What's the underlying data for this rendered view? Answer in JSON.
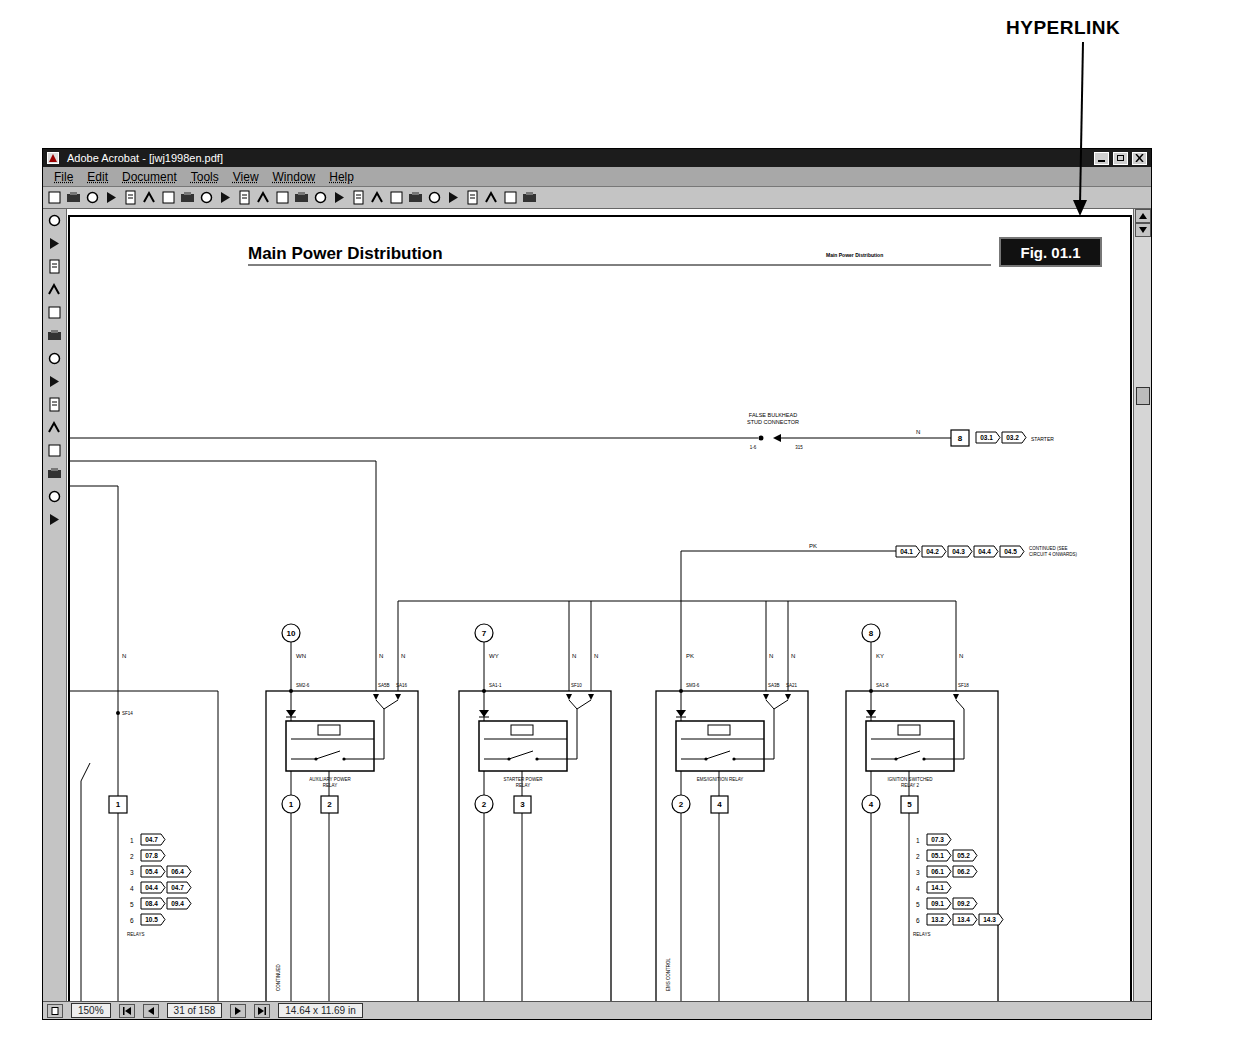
{
  "annotation": {
    "label": "HYPERLINK"
  },
  "window": {
    "title": "Adobe Acrobat - [jwj1998en.pdf]"
  },
  "menu": [
    "File",
    "Edit",
    "Document",
    "Tools",
    "View",
    "Window",
    "Help"
  ],
  "page": {
    "title": "Main Power Distribution",
    "header_note": "Main Power Distribution",
    "figure": "Fig. 01.1"
  },
  "diagram": {
    "starter_feed": {
      "connector": [
        "FALSE BULKHEAD",
        "STUD CONNECTOR"
      ],
      "pins": [
        "1-6",
        "315"
      ],
      "wire": "N",
      "box": "8",
      "links": [
        "03.1",
        "03.2"
      ],
      "destination": "STARTER"
    },
    "pk_feed": {
      "wire": "PK",
      "links": [
        "04.1",
        "04.2",
        "04.3",
        "04.4",
        "04.5"
      ],
      "destination": [
        "CONTINUED (SEE",
        "CIRCUIT 4 ONWARDS)"
      ]
    },
    "feed_branch": {
      "wire": "N",
      "pin": "SF14",
      "box": "1"
    },
    "relays": [
      {
        "kind": "fused",
        "fuse": "10",
        "wire": "WN",
        "top_pin": "SM2-6",
        "right_pins": [
          "SA5B",
          "SA16"
        ],
        "right_wires": [
          "N",
          "N"
        ],
        "name": [
          "AUXILIARY POWER",
          "RELAY"
        ],
        "ground": "1",
        "box": "2",
        "side_note": "CONTINUED"
      },
      {
        "kind": "fused",
        "fuse": "7",
        "wire": "WY",
        "top_pin": "SA1-1",
        "right_pins": [
          "SF10"
        ],
        "right_wires": [
          "N",
          "N"
        ],
        "name": [
          "STARTER POWER",
          "RELAY"
        ],
        "ground": "2",
        "box": "3"
      },
      {
        "kind": "feed",
        "wire": "PK",
        "top_pin": "SM3-6",
        "right_pins": [
          "SA3B",
          "SA21"
        ],
        "right_wires": [
          "N",
          "N"
        ],
        "name": [
          "EMS/IGNITION RELAY"
        ],
        "ground": "2",
        "box": "4",
        "side_note": "EMS CONTROL"
      },
      {
        "kind": "fused",
        "fuse": "8",
        "wire": "KY",
        "top_pin": "SA1-8",
        "right_pins": [
          "SF18"
        ],
        "right_wires": [
          "N"
        ],
        "name": [
          "IGNITION SWITCHED",
          "RELAY 2"
        ],
        "ground": "4",
        "box": "5"
      }
    ],
    "lists": [
      {
        "label": "RELAYS",
        "rows": [
          {
            "num": "1",
            "links": [
              "04.7"
            ]
          },
          {
            "num": "2",
            "links": [
              "07.8"
            ]
          },
          {
            "num": "3",
            "links": [
              "05.4",
              "06.4"
            ]
          },
          {
            "num": "4",
            "links": [
              "04.4",
              "04.7"
            ]
          },
          {
            "num": "5",
            "links": [
              "08.4",
              "09.4"
            ]
          },
          {
            "num": "6",
            "links": [
              "10.5"
            ]
          }
        ]
      },
      {
        "label": "RELAYS",
        "rows": [
          {
            "num": "1",
            "links": [
              "07.3"
            ]
          },
          {
            "num": "2",
            "links": [
              "05.1",
              "05.2"
            ]
          },
          {
            "num": "3",
            "links": [
              "06.1",
              "06.2"
            ]
          },
          {
            "num": "4",
            "links": [
              "14.1"
            ]
          },
          {
            "num": "5",
            "links": [
              "09.1",
              "09.2"
            ]
          },
          {
            "num": "6",
            "links": [
              "13.2",
              "13.4",
              "14.3"
            ]
          }
        ]
      }
    ]
  },
  "status_bar": {
    "zoom": "150%",
    "page": "31 of 158",
    "size": "14.64 x 11.69 in"
  }
}
